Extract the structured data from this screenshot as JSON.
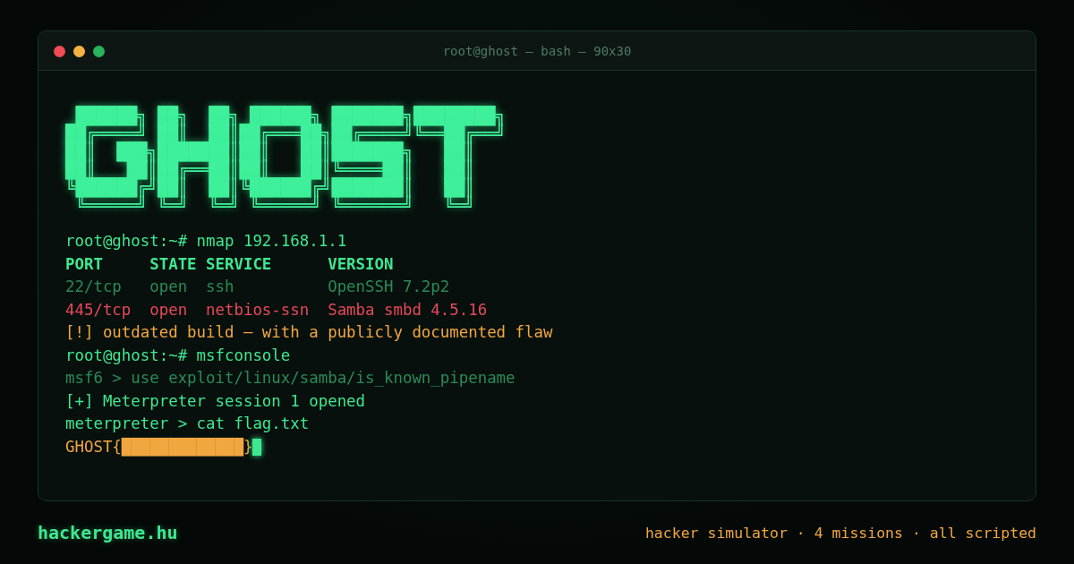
{
  "window": {
    "title": "root@ghost — bash — 90x30"
  },
  "banner": [
    " ██████╗ ██╗  ██╗ ██████╗ ███████╗████████╗",
    "██╔════╝ ██║  ██║██╔═══██╗██╔════╝╚══██╔══╝",
    "██║  ███╗███████║██║   ██║███████╗   ██║   ",
    "██║   ██║██╔══██║██║   ██║╚════██║   ██║   ",
    "╚██████╔╝██║  ██║╚██████╔╝███████║   ██║   ",
    " ╚═════╝ ╚═╝  ╚═╝ ╚═════╝ ╚══════╝   ╚═╝   "
  ],
  "lines": [
    {
      "kind": "prompt",
      "text": "root@ghost:~# nmap 192.168.1.1"
    },
    {
      "kind": "header",
      "text": "PORT     STATE SERVICE      VERSION"
    },
    {
      "kind": "muted",
      "text": "22/tcp   open  ssh          OpenSSH 7.2p2"
    },
    {
      "kind": "alert",
      "text": "445/tcp  open  netbios-ssn  Samba smbd 4.5.16"
    },
    {
      "kind": "warning",
      "text": "[!] outdated build — with a publicly documented flaw"
    },
    {
      "kind": "prompt",
      "text": "root@ghost:~# msfconsole"
    },
    {
      "kind": "muted",
      "text": "msf6 > use exploit/linux/samba/is_known_pipename"
    },
    {
      "kind": "prompt",
      "text": "[+] Meterpreter session 1 opened"
    },
    {
      "kind": "prompt",
      "text": "meterpreter > cat flag.txt"
    }
  ],
  "flag": {
    "prefix": "GHOST{",
    "redacted": "█████████████",
    "suffix": "}"
  },
  "footer": {
    "site": "hackergame.hu",
    "tagline": "hacker simulator · 4 missions · all scripted"
  }
}
